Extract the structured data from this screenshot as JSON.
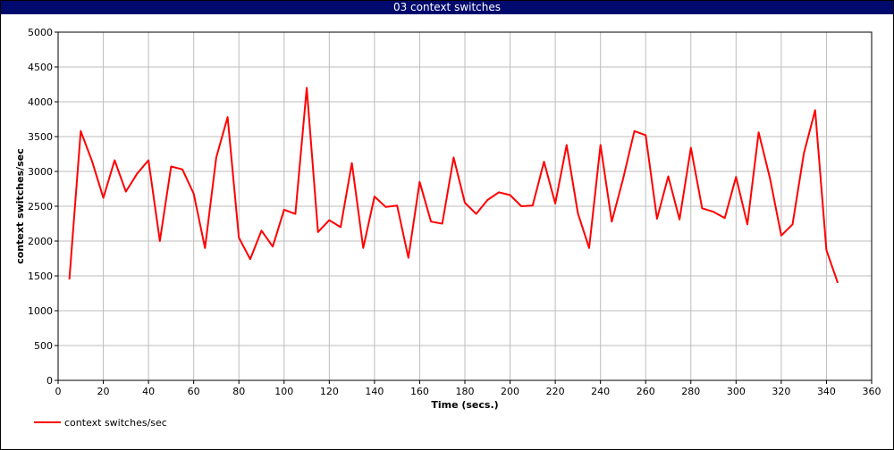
{
  "window": {
    "title": "03 context switches"
  },
  "chart_data": {
    "type": "line",
    "title": "03 context switches",
    "xlabel": "Time (secs.)",
    "ylabel": "context switches/sec",
    "xlim": [
      0,
      360
    ],
    "ylim": [
      0,
      5000
    ],
    "xticks": [
      0,
      20,
      40,
      60,
      80,
      100,
      120,
      140,
      160,
      180,
      200,
      220,
      240,
      260,
      280,
      300,
      320,
      340,
      360
    ],
    "yticks": [
      0,
      500,
      1000,
      1500,
      2000,
      2500,
      3000,
      3500,
      4000,
      4500,
      5000
    ],
    "grid": true,
    "legend_position": "bottom-left",
    "series": [
      {
        "name": "context switches/sec",
        "color": "#ff0000",
        "x": [
          5,
          10,
          15,
          20,
          25,
          30,
          35,
          40,
          45,
          50,
          55,
          60,
          65,
          70,
          75,
          80,
          85,
          90,
          95,
          100,
          105,
          110,
          115,
          120,
          125,
          130,
          135,
          140,
          145,
          150,
          155,
          160,
          165,
          170,
          175,
          180,
          185,
          190,
          195,
          200,
          205,
          210,
          215,
          220,
          225,
          230,
          235,
          240,
          245,
          250,
          255,
          260,
          265,
          270,
          275,
          280,
          285,
          290,
          295,
          300,
          305,
          310,
          315,
          320,
          325,
          330,
          335,
          340,
          345
        ],
        "y": [
          1450,
          3580,
          3150,
          2620,
          3160,
          2710,
          2970,
          3160,
          2000,
          3070,
          3030,
          2680,
          1900,
          3200,
          3780,
          2050,
          1740,
          2150,
          1920,
          2450,
          2390,
          4200,
          2130,
          2300,
          2200,
          3120,
          1900,
          2640,
          2490,
          2510,
          1760,
          2850,
          2280,
          2250,
          3200,
          2550,
          2390,
          2590,
          2700,
          2660,
          2500,
          2510,
          3140,
          2540,
          3380,
          2400,
          1900,
          3380,
          2280,
          2890,
          3580,
          3520,
          2320,
          2930,
          2310,
          3340,
          2470,
          2420,
          2330,
          2920,
          2240,
          3560,
          2900,
          2080,
          2240,
          3260,
          3880,
          1870,
          1400
        ]
      }
    ]
  }
}
